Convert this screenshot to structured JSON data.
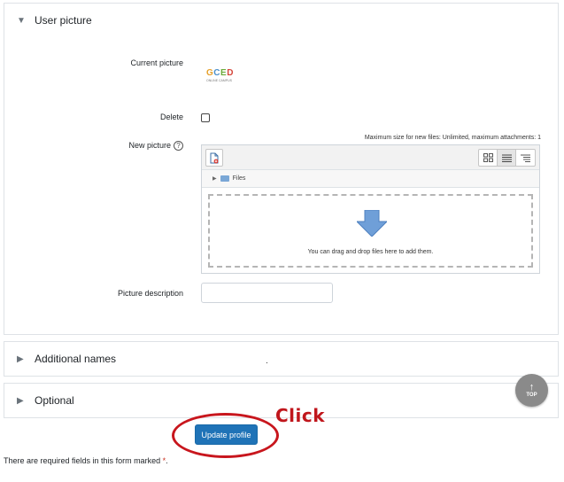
{
  "sections": {
    "user_picture": {
      "title": "User picture",
      "expanded": true
    },
    "additional_names": {
      "title": "Additional names",
      "expanded": false
    },
    "optional": {
      "title": "Optional",
      "expanded": false
    }
  },
  "fields": {
    "current_picture_label": "Current picture",
    "delete_label": "Delete",
    "new_picture_label": "New picture",
    "picture_description_label": "Picture description",
    "picture_description_value": ""
  },
  "logo": {
    "letters": [
      "G",
      "C",
      "E",
      "D"
    ],
    "subtitle": "ONLINE CAMPUS"
  },
  "filemanager": {
    "max_size_text": "Maximum size for new files: Unlimited, maximum attachments: 1",
    "path_label": "Files",
    "drop_message": "You can drag and drop files here to add them."
  },
  "top_button": {
    "label": "TOP"
  },
  "annotation": {
    "click_text": "Click"
  },
  "actions": {
    "update_profile_label": "Update profile"
  },
  "footer": {
    "required_note": "There are required fields in this form marked",
    "required_star": "*",
    "period": "."
  },
  "colors": {
    "primary": "#1f73b7",
    "annotation_red": "#c8161d",
    "required_star": "#ca3120",
    "logo": [
      "#e6a02a",
      "#4a8fc9",
      "#6aaa3a",
      "#d4453a"
    ]
  }
}
